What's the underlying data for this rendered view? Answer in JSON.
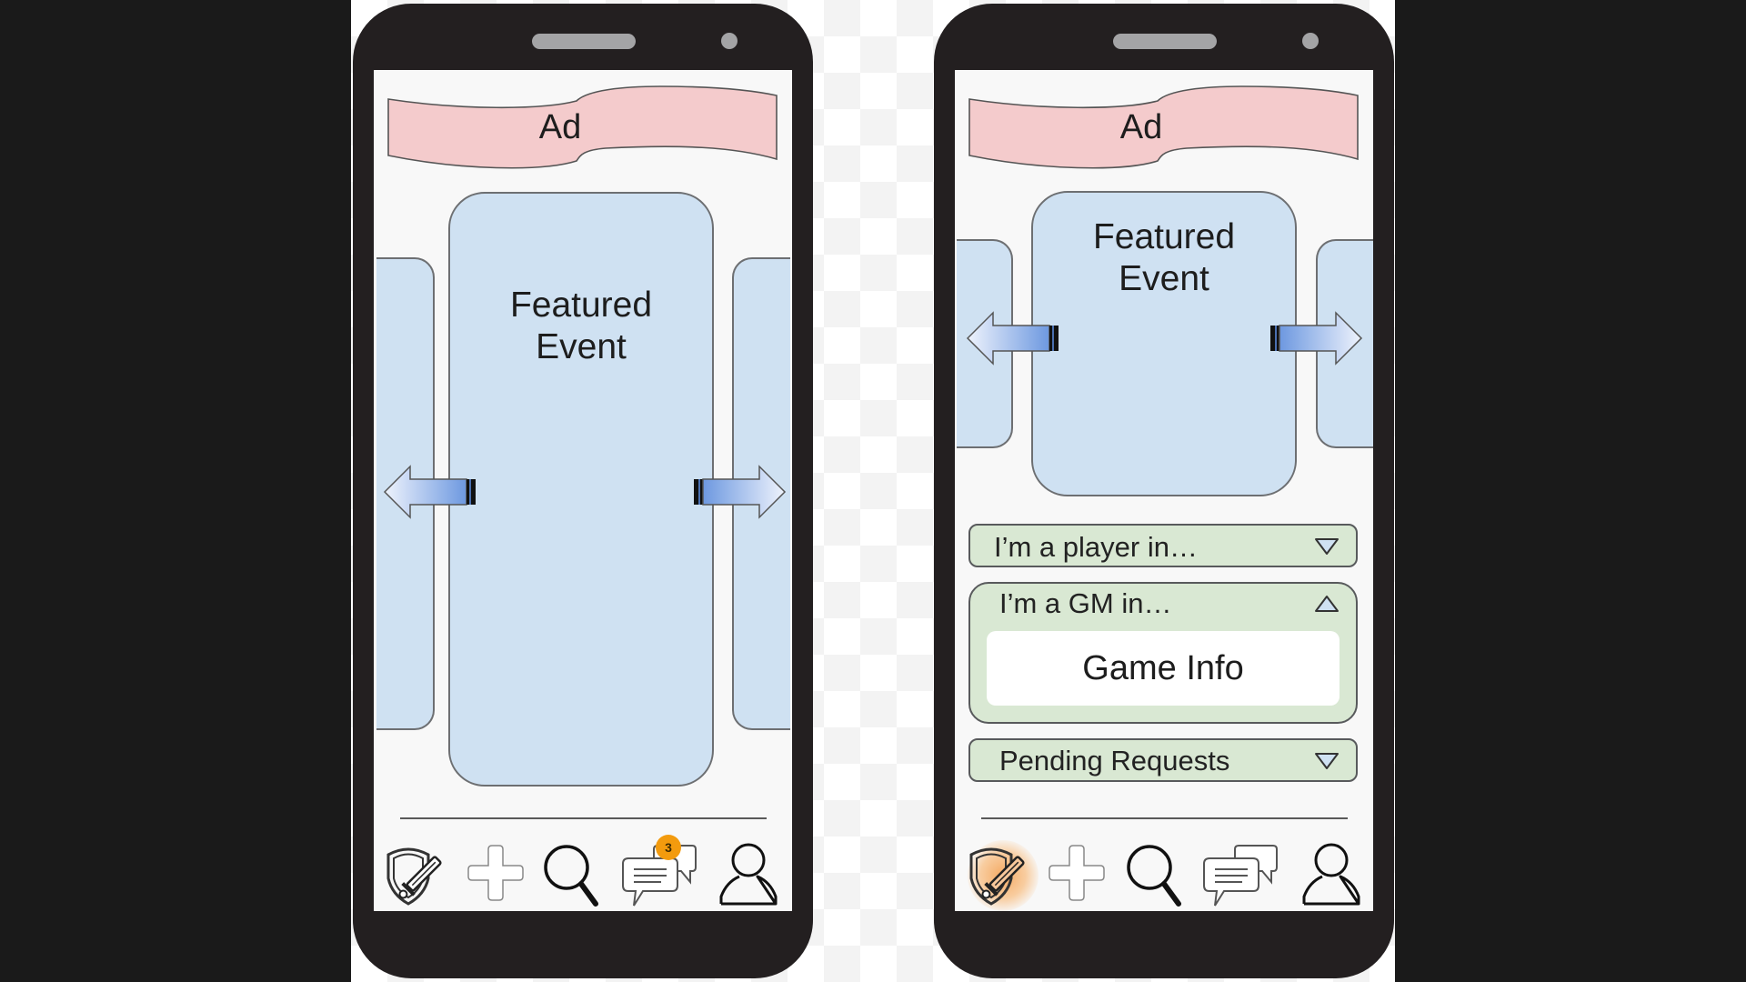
{
  "colors": {
    "background": "#1a1a1a",
    "phone_body": "#231f20",
    "ad_fill": "#f4cbcc",
    "card_fill": "#cfe1f2",
    "accordion_fill": "#d9e8d3",
    "badge": "#f39b0e",
    "active_glow": "#f5a55a"
  },
  "screens": [
    {
      "ad_label": "Ad",
      "featured_title_line1": "Featured",
      "featured_title_line2": "Event",
      "carousel_prev_icon": "arrow-left-icon",
      "carousel_next_icon": "arrow-right-icon",
      "nav": [
        {
          "icon": "shield-sword-icon",
          "label": "Home",
          "active": false
        },
        {
          "icon": "plus-icon",
          "label": "Create",
          "active": false
        },
        {
          "icon": "search-icon",
          "label": "Search",
          "active": false
        },
        {
          "icon": "chat-bubbles-icon",
          "label": "Messages",
          "active": false,
          "badge": "3"
        },
        {
          "icon": "user-icon",
          "label": "Profile",
          "active": false
        }
      ]
    },
    {
      "ad_label": "Ad",
      "featured_title_line1": "Featured",
      "featured_title_line2": "Event",
      "carousel_prev_icon": "arrow-left-icon",
      "carousel_next_icon": "arrow-right-icon",
      "sections": [
        {
          "label": "I’m a player in…",
          "expanded": false,
          "caret": "triangle-down-icon"
        },
        {
          "label": "I’m a GM in…",
          "expanded": true,
          "caret": "triangle-up-icon",
          "items": [
            "Game Info"
          ]
        },
        {
          "label": "Pending Requests",
          "expanded": false,
          "caret": "triangle-down-icon"
        }
      ],
      "nav": [
        {
          "icon": "shield-sword-icon",
          "label": "Home",
          "active": true
        },
        {
          "icon": "plus-icon",
          "label": "Create",
          "active": false
        },
        {
          "icon": "search-icon",
          "label": "Search",
          "active": false
        },
        {
          "icon": "chat-bubbles-icon",
          "label": "Messages",
          "active": false
        },
        {
          "icon": "user-icon",
          "label": "Profile",
          "active": false
        }
      ]
    }
  ]
}
